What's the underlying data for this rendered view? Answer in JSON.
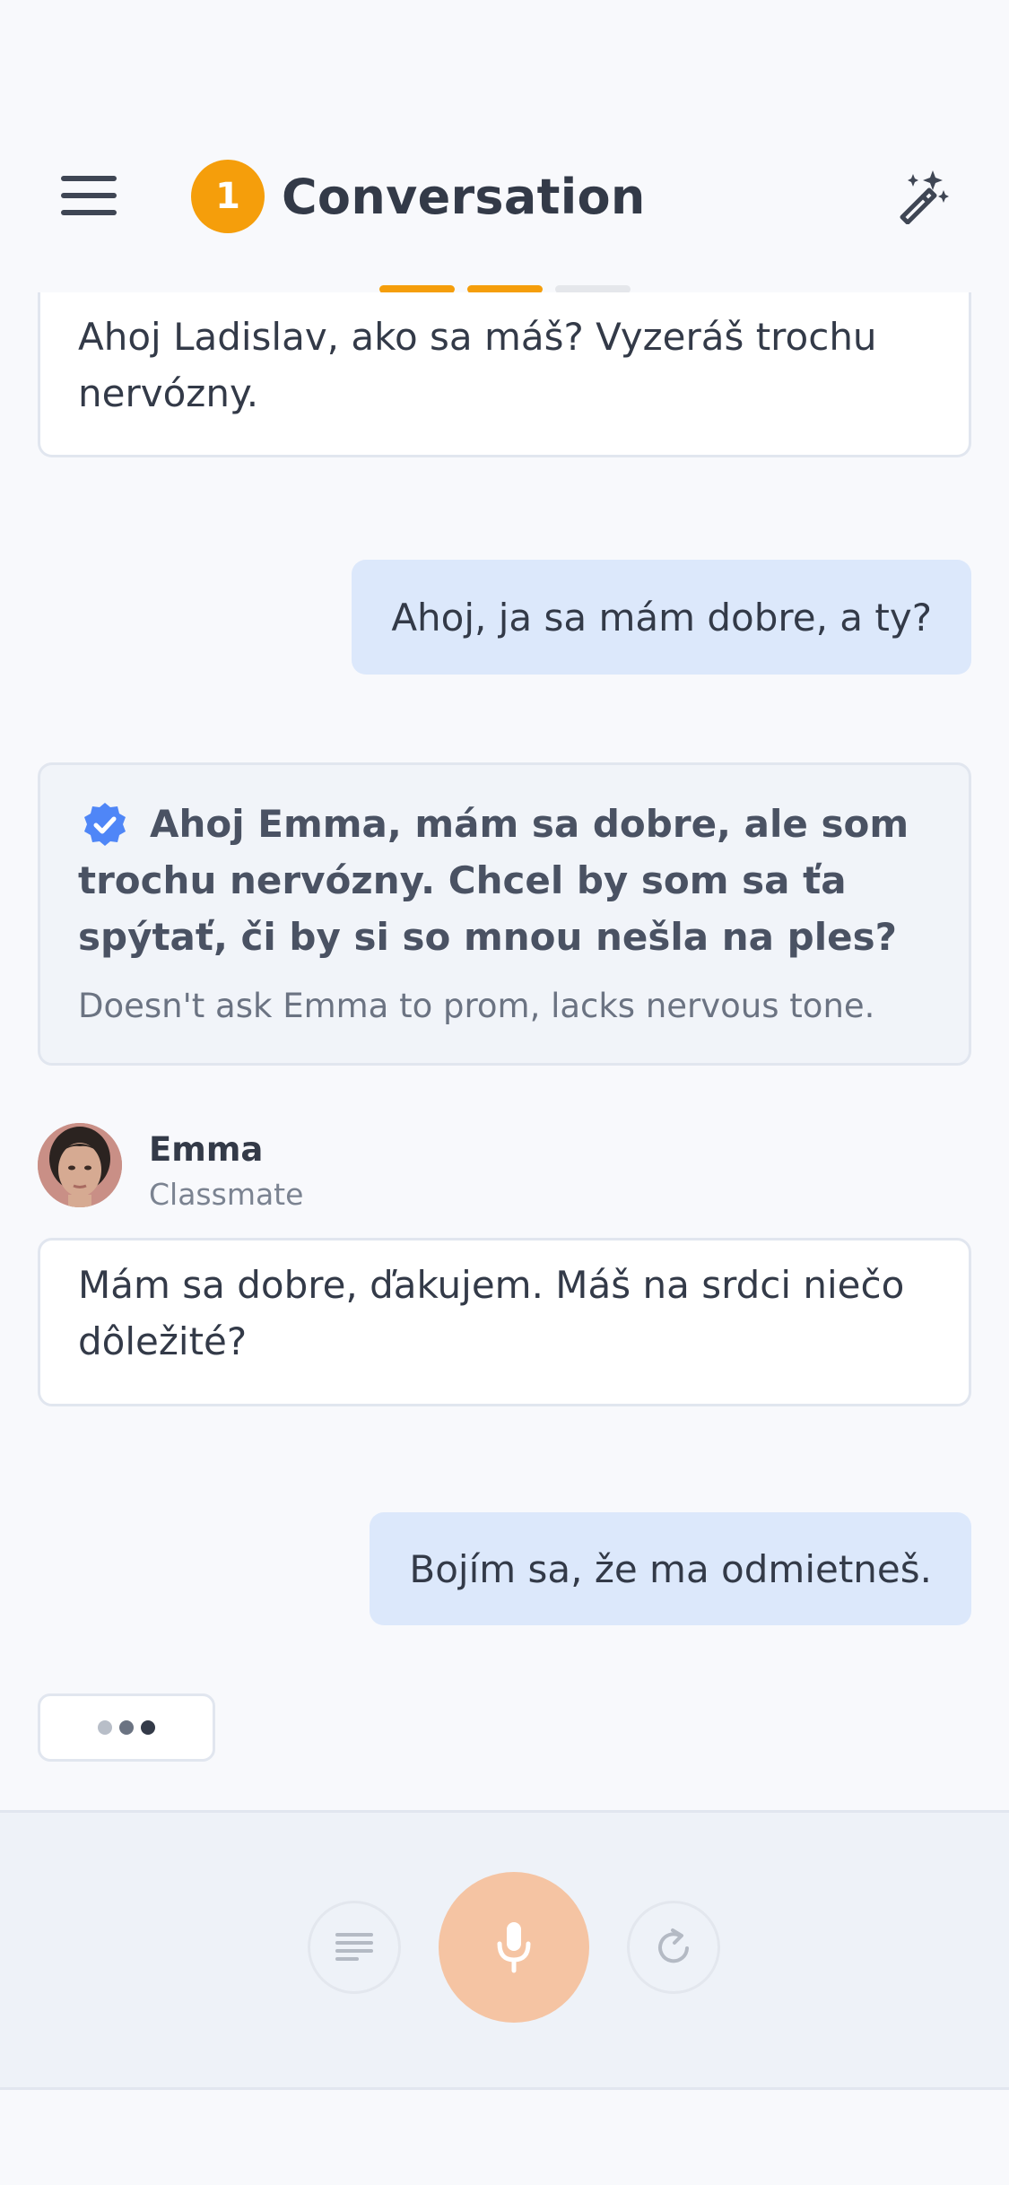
{
  "header": {
    "step_number": "1",
    "title": "Conversation",
    "menu_icon": "hamburger-menu-icon",
    "action_icon": "magic-wand-icon",
    "progress": [
      {
        "state": "done",
        "color": "#f59e0b"
      },
      {
        "state": "done",
        "color": "#f59e0b"
      },
      {
        "state": "pending",
        "color": "#e5e7eb"
      }
    ]
  },
  "messages": {
    "ai_1": "Ahoj Ladislav, ako sa máš? Vyzeráš trochu nervózny.",
    "user_1": "Ahoj, ja sa mám dobre, a ty?",
    "feedback": {
      "suggestion": "Ahoj Emma, mám sa dobre, ale som trochu nervózny. Chcel by som sa ťa spýtať, či by si so mnou nešla na ples?",
      "note": "Doesn't ask Emma to prom, lacks nervous tone.",
      "icon": "verified-badge-icon"
    },
    "speaker": {
      "name": "Emma",
      "role": "Classmate"
    },
    "ai_2": "Mám sa dobre, ďakujem. Máš na srdci niečo dôležité?",
    "user_2": "Bojím sa, že ma odmietneš."
  },
  "controls": {
    "left_icon": "text-lines-icon",
    "center_icon": "microphone-icon",
    "right_icon": "refresh-icon"
  },
  "colors": {
    "accent": "#f59e0b",
    "user_bubble": "#dce8fb",
    "mic_button": "#f5c4a3",
    "verified": "#4f86f7"
  }
}
